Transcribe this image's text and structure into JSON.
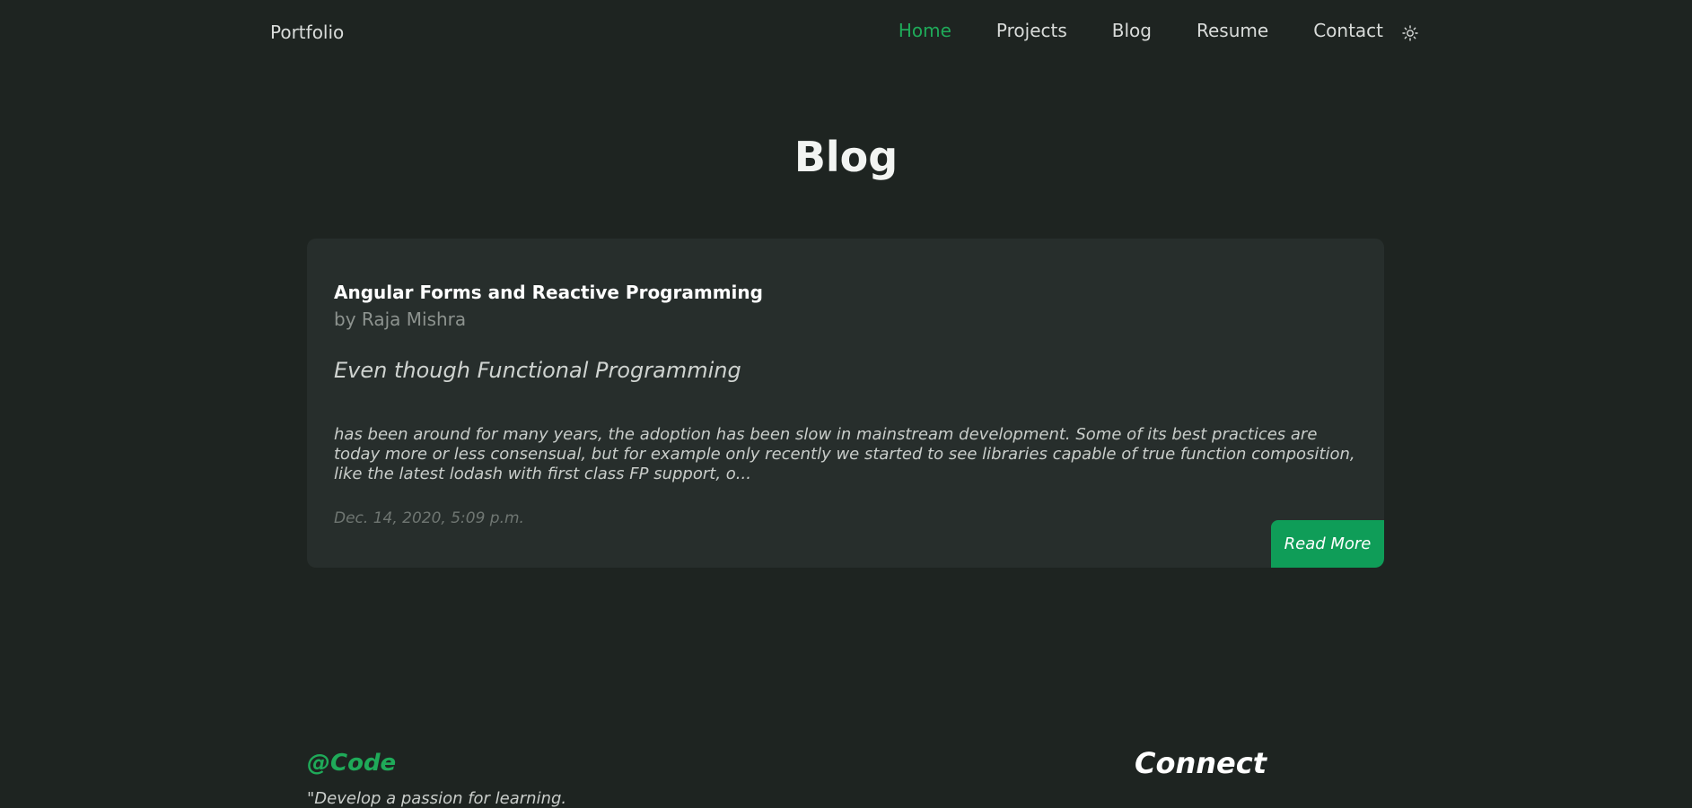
{
  "nav": {
    "brand": "Portfolio",
    "links": [
      {
        "label": "Home",
        "active": true
      },
      {
        "label": "Projects",
        "active": false
      },
      {
        "label": "Blog",
        "active": false
      },
      {
        "label": "Resume",
        "active": false
      },
      {
        "label": "Contact",
        "active": false
      }
    ],
    "theme_icon": "sun-icon"
  },
  "page": {
    "title": "Blog"
  },
  "post": {
    "title": "Angular Forms and Reactive Programming",
    "author": "by Raja Mishra",
    "lead": "Even though Functional Programming",
    "excerpt": "has been around for many years, the adoption has been slow in mainstream development. Some of its best practices are today more or less consensual, but for example only recently we started to see libraries capable of true function composition, like the latest lodash with first class FP support, o...",
    "date": "Dec. 14, 2020, 5:09 p.m.",
    "read_more_label": "Read More"
  },
  "footer": {
    "brand": "@Code",
    "quote": "\"Develop a passion for learning.",
    "connect_heading": "Connect"
  },
  "colors": {
    "background": "#1e2421",
    "card": "#272e2c",
    "accent": "#1faa59",
    "button": "#0f9d58"
  }
}
